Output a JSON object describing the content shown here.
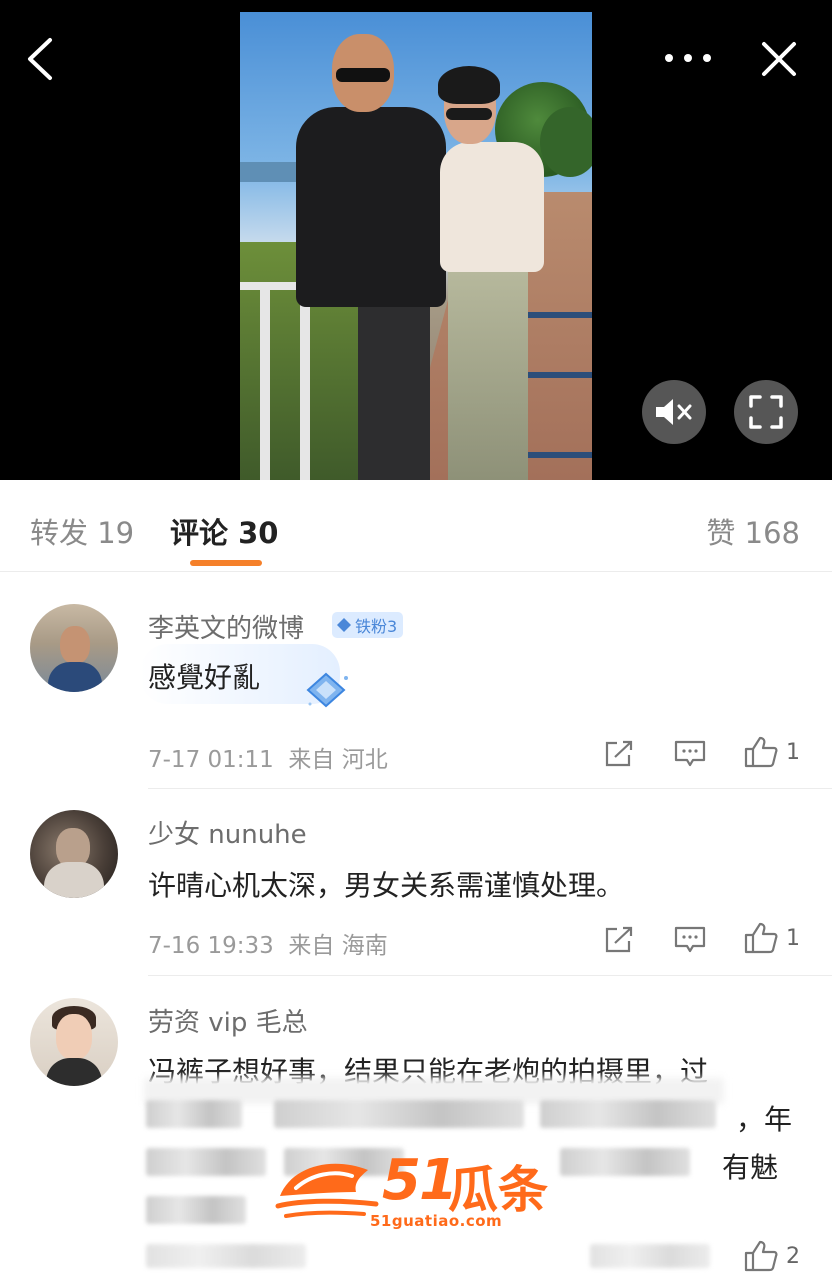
{
  "video": {
    "nav_icons": [
      "back-chevron-icon",
      "more-dots-icon",
      "close-x-icon"
    ],
    "control_icons": [
      "mute-speaker-icon",
      "fullscreen-icon"
    ]
  },
  "tabs": {
    "forward": "转发 19",
    "comments": "评论 30",
    "likes": "赞 168",
    "active": "comments",
    "accent_color": "#f5802a"
  },
  "comments": [
    {
      "user": "李英文的微博",
      "badge": "铁粉3",
      "text": "感覺好亂",
      "time": "7-17 01:11",
      "location": "来自 河北",
      "likes": "1"
    },
    {
      "user": "少女 nunuhe",
      "text": "许晴心机太深，男女关系需谨慎处理。",
      "time": "7-16 19:33",
      "location": "来自 海南",
      "likes": "1"
    },
    {
      "user": "劳资 vip 毛总",
      "line1": "冯裤子想好事，结果只能在老炮的拍摄里，过",
      "line2_tail": "，年",
      "line3_tail": "有魅",
      "likes": "2"
    }
  ],
  "watermark": {
    "number": "51",
    "name": "瓜条",
    "url": "51guatiao.com"
  }
}
